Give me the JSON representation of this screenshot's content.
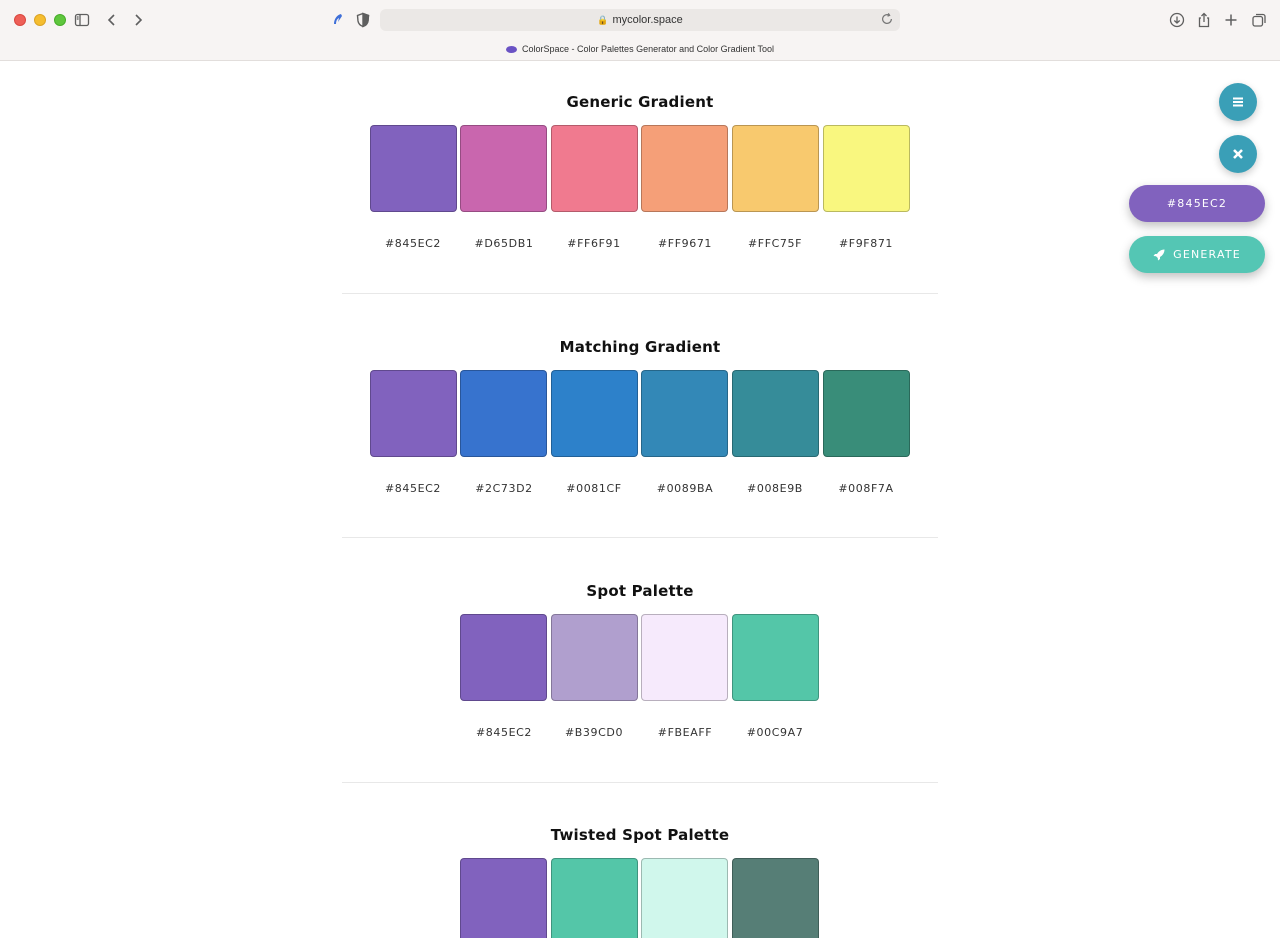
{
  "browser": {
    "url": "mycolor.space",
    "tab_title": "ColorSpace - Color Palettes Generator and Color Gradient Tool"
  },
  "sections": [
    {
      "title": "Generic Gradient",
      "colors": [
        {
          "hex": "#845EC2",
          "fill": "#8162be"
        },
        {
          "hex": "#D65DB1",
          "fill": "#c966ae"
        },
        {
          "hex": "#FF6F91",
          "fill": "#f07a8f"
        },
        {
          "hex": "#FF9671",
          "fill": "#f59f78"
        },
        {
          "hex": "#FFC75F",
          "fill": "#f8c96e"
        },
        {
          "hex": "#F9F871",
          "fill": "#f9f77f"
        }
      ]
    },
    {
      "title": "Matching Gradient",
      "colors": [
        {
          "hex": "#845EC2",
          "fill": "#8162be"
        },
        {
          "hex": "#2C73D2",
          "fill": "#3773ce"
        },
        {
          "hex": "#0081CF",
          "fill": "#2d81ca"
        },
        {
          "hex": "#0089BA",
          "fill": "#3388b7"
        },
        {
          "hex": "#008E9B",
          "fill": "#368c99"
        },
        {
          "hex": "#008F7A",
          "fill": "#398d79"
        }
      ]
    },
    {
      "title": "Spot Palette",
      "colors": [
        {
          "hex": "#845EC2",
          "fill": "#8162be"
        },
        {
          "hex": "#B39CD0",
          "fill": "#b09fce"
        },
        {
          "hex": "#FBEAFF",
          "fill": "#f6eafc"
        },
        {
          "hex": "#00C9A7",
          "fill": "#54c6a8"
        }
      ]
    },
    {
      "title": "Twisted Spot Palette",
      "colors": [
        {
          "hex": "",
          "fill": "#8162be"
        },
        {
          "hex": "",
          "fill": "#54c6a8"
        },
        {
          "hex": "",
          "fill": "#d0f7ec"
        },
        {
          "hex": "",
          "fill": "#567e76"
        }
      ]
    }
  ],
  "controls": {
    "current_color": "#845EC2",
    "generate_label": "GENERATE",
    "accent": "#3a9fb7",
    "pill_color": "#8162be",
    "generate_color": "#54c6b4"
  },
  "icons": [
    "sidebar-icon",
    "back-icon",
    "forward-icon",
    "privacy-icon",
    "shield-icon",
    "lock-icon",
    "reload-icon",
    "download-icon",
    "share-icon",
    "new-tab-icon",
    "tabs-overview-icon",
    "menu-icon",
    "close-icon",
    "rocket-icon"
  ]
}
